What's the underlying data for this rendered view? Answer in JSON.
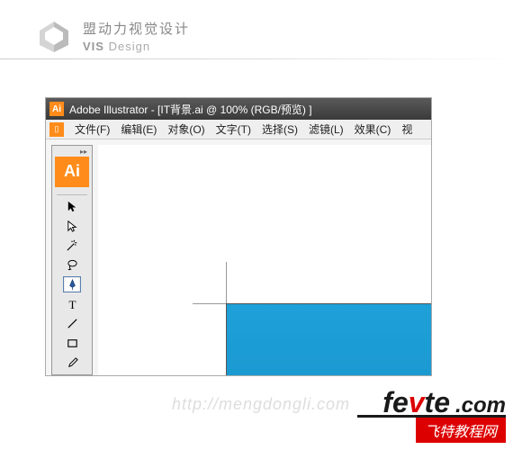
{
  "header": {
    "brand_cn": "盟动力视觉设计",
    "brand_en_vis": "VIS",
    "brand_en_design": "Design"
  },
  "titlebar": {
    "icon_text": "Ai",
    "text": "Adobe Illustrator - [IT背景.ai @ 100% (RGB/预览) ]"
  },
  "menubar": {
    "icon_text": "▯",
    "items": [
      "文件(F)",
      "编辑(E)",
      "对象(O)",
      "文字(T)",
      "选择(S)",
      "滤镜(L)",
      "效果(C)",
      "视"
    ]
  },
  "toolbox": {
    "logo_text": "Ai",
    "tools": [
      {
        "name": "selection-tool",
        "glyph": "arrow",
        "selected": false
      },
      {
        "name": "direct-selection-tool",
        "glyph": "arrow-white",
        "selected": false
      },
      {
        "name": "magic-wand-tool",
        "glyph": "wand",
        "selected": false
      },
      {
        "name": "lasso-tool",
        "glyph": "lasso",
        "selected": false
      },
      {
        "name": "pen-tool",
        "glyph": "pen",
        "selected": true
      },
      {
        "name": "type-tool",
        "glyph": "type",
        "selected": false
      },
      {
        "name": "line-tool",
        "glyph": "line",
        "selected": false
      },
      {
        "name": "rectangle-tool",
        "glyph": "rect",
        "selected": false
      },
      {
        "name": "paintbrush-tool",
        "glyph": "brush",
        "selected": false
      }
    ]
  },
  "canvas": {
    "artboard_color": "#1ea0d8"
  },
  "watermark": "http://mengdongli.com",
  "footer": {
    "fe": "fe",
    "v": "v",
    "te": "te",
    "com": ".com",
    "cn": "飞特教程网"
  }
}
